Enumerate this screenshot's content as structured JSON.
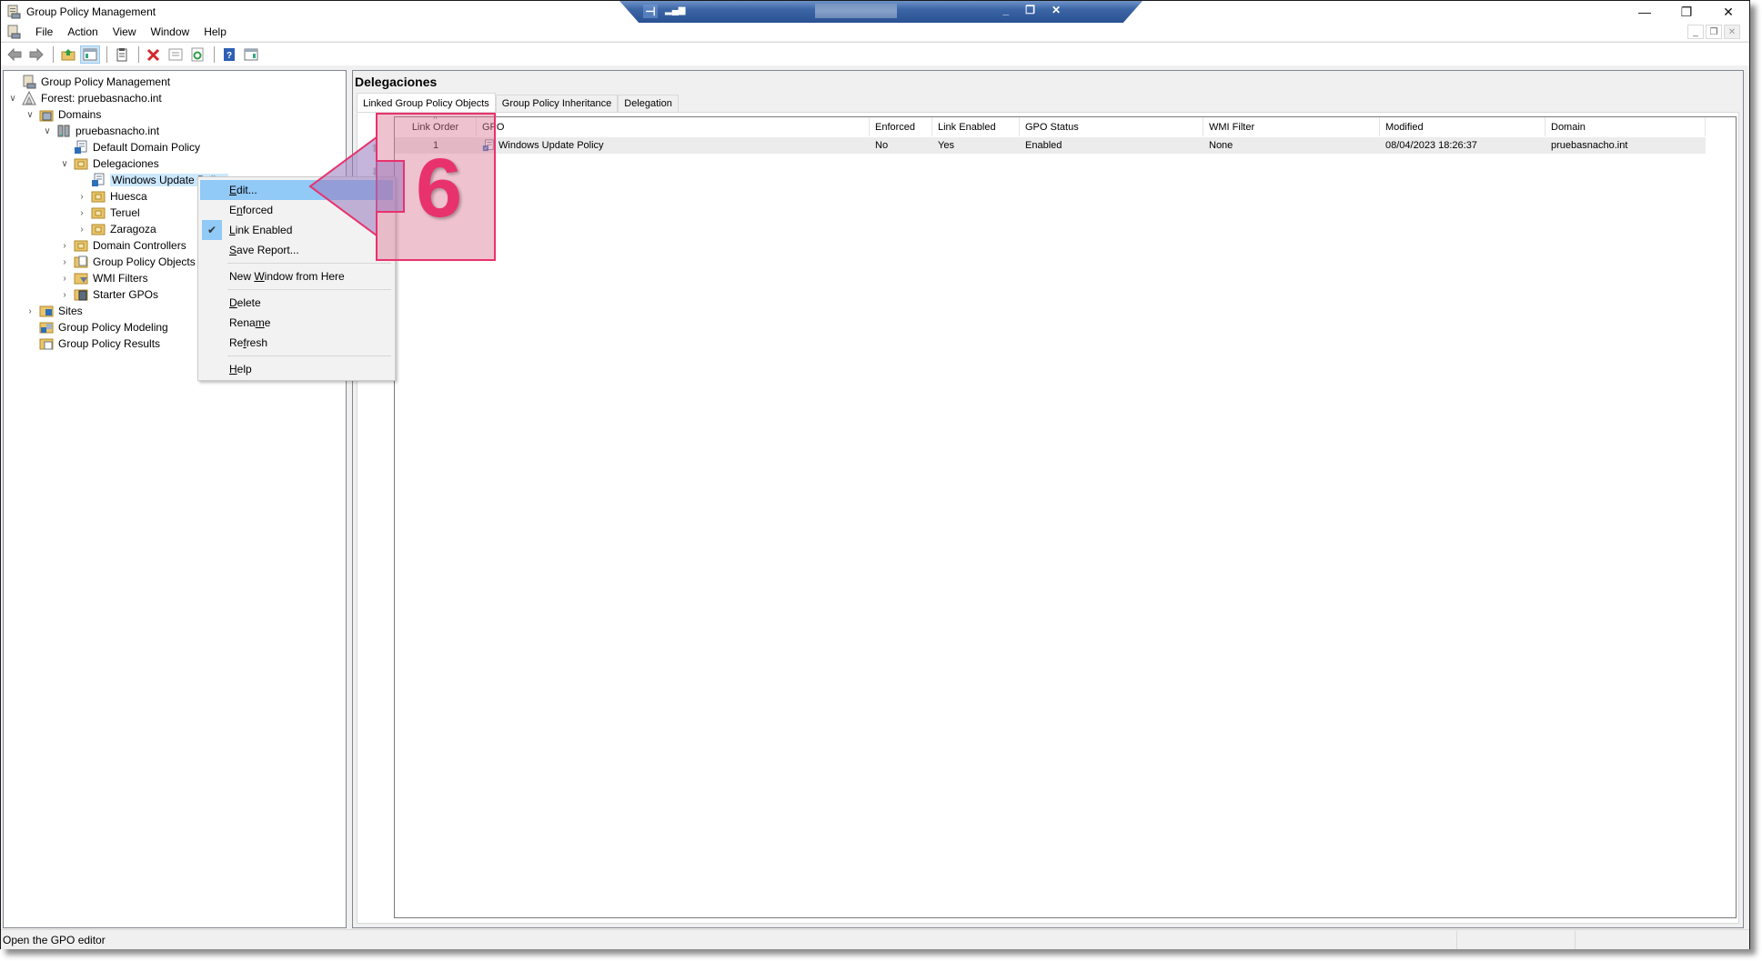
{
  "window": {
    "title": "Group Policy Management",
    "controls": {
      "minimize": "—",
      "restore": "❐",
      "close": "✕"
    }
  },
  "rdp_bar": {
    "pin_icon": "pin-icon",
    "signal_icon": "signal-icon",
    "controls": {
      "minimize": "_",
      "restore": "❐",
      "close": "✕"
    }
  },
  "menubar": {
    "items": [
      "File",
      "Action",
      "View",
      "Window",
      "Help"
    ],
    "mdi_controls": {
      "minimize": "_",
      "restore": "❐",
      "close": "✕"
    }
  },
  "toolbar": {
    "buttons": [
      "back-icon",
      "forward-icon",
      "up-folder-icon",
      "show-hide-tree-icon",
      "clipboard-icon",
      "delete-icon",
      "properties-icon",
      "refresh-icon",
      "help-icon",
      "show-hide-action-pane-icon"
    ],
    "pressed": "show-hide-tree-icon"
  },
  "tree": {
    "items": [
      {
        "label": "Group Policy Management",
        "icon": "gpm-icon",
        "level": 0,
        "chevron": ""
      },
      {
        "label": "Forest: pruebasnacho.int",
        "icon": "forest-icon",
        "level": 0,
        "chevron": "∨"
      },
      {
        "label": "Domains",
        "icon": "domains-icon",
        "level": 1,
        "chevron": "∨"
      },
      {
        "label": "pruebasnacho.int",
        "icon": "domain-icon",
        "level": 2,
        "chevron": "∨"
      },
      {
        "label": "Default Domain Policy",
        "icon": "gpo-link-icon",
        "level": 3,
        "chevron": ""
      },
      {
        "label": "Delegaciones",
        "icon": "ou-icon",
        "level": 3,
        "chevron": "∨"
      },
      {
        "label": "Windows Update Policy",
        "icon": "gpo-link-icon",
        "level": 4,
        "chevron": "",
        "selected": true
      },
      {
        "label": "Huesca",
        "icon": "ou-icon",
        "level": 4,
        "chevron": "›"
      },
      {
        "label": "Teruel",
        "icon": "ou-icon",
        "level": 4,
        "chevron": "›"
      },
      {
        "label": "Zaragoza",
        "icon": "ou-icon",
        "level": 4,
        "chevron": "›"
      },
      {
        "label": "Domain Controllers",
        "icon": "ou-icon",
        "level": 3,
        "chevron": "›"
      },
      {
        "label": "Group Policy Objects",
        "icon": "gpo-folder-icon",
        "level": 3,
        "chevron": "›"
      },
      {
        "label": "WMI Filters",
        "icon": "wmi-folder-icon",
        "level": 3,
        "chevron": "›"
      },
      {
        "label": "Starter GPOs",
        "icon": "starter-folder-icon",
        "level": 3,
        "chevron": "›"
      },
      {
        "label": "Sites",
        "icon": "sites-icon",
        "level": 1,
        "chevron": "›"
      },
      {
        "label": "Group Policy Modeling",
        "icon": "modeling-icon",
        "level": 1,
        "chevron": ""
      },
      {
        "label": "Group Policy Results",
        "icon": "results-icon",
        "level": 1,
        "chevron": ""
      }
    ]
  },
  "context_menu": {
    "items": [
      {
        "label": "Edit...",
        "underline": "E",
        "highlighted": true
      },
      {
        "label": "Enforced",
        "underline": "n"
      },
      {
        "label": "Link Enabled",
        "underline": "L",
        "checked": true
      },
      {
        "label": "Save Report...",
        "underline": "S"
      },
      {
        "label": "New Window from Here",
        "underline": "W"
      },
      {
        "label": "Delete",
        "underline": "D"
      },
      {
        "label": "Rename",
        "underline": "m"
      },
      {
        "label": "Refresh",
        "underline": "f"
      },
      {
        "label": "Help",
        "underline": "H"
      }
    ]
  },
  "details": {
    "heading": "Delegaciones",
    "tabs": [
      {
        "label": "Linked Group Policy Objects",
        "active": true
      },
      {
        "label": "Group Policy Inheritance"
      },
      {
        "label": "Delegation"
      }
    ],
    "columns": [
      "Link Order",
      "GPO",
      "Enforced",
      "Link Enabled",
      "GPO Status",
      "WMI Filter",
      "Modified",
      "Domain"
    ],
    "sorted_column": "Link Order",
    "rows": [
      {
        "link_order": "1",
        "gpo": "Windows Update Policy",
        "enforced": "No",
        "link_enabled": "Yes",
        "gpo_status": "Enabled",
        "wmi_filter": "None",
        "modified": "08/04/2023 18:26:37",
        "domain": "pruebasnacho.int"
      }
    ],
    "move_up_icon": "⬆",
    "move_down_icon": "⬇"
  },
  "annotation": {
    "step_number": "6",
    "color": "#e8326e"
  },
  "status": {
    "message": "Open the GPO editor"
  }
}
